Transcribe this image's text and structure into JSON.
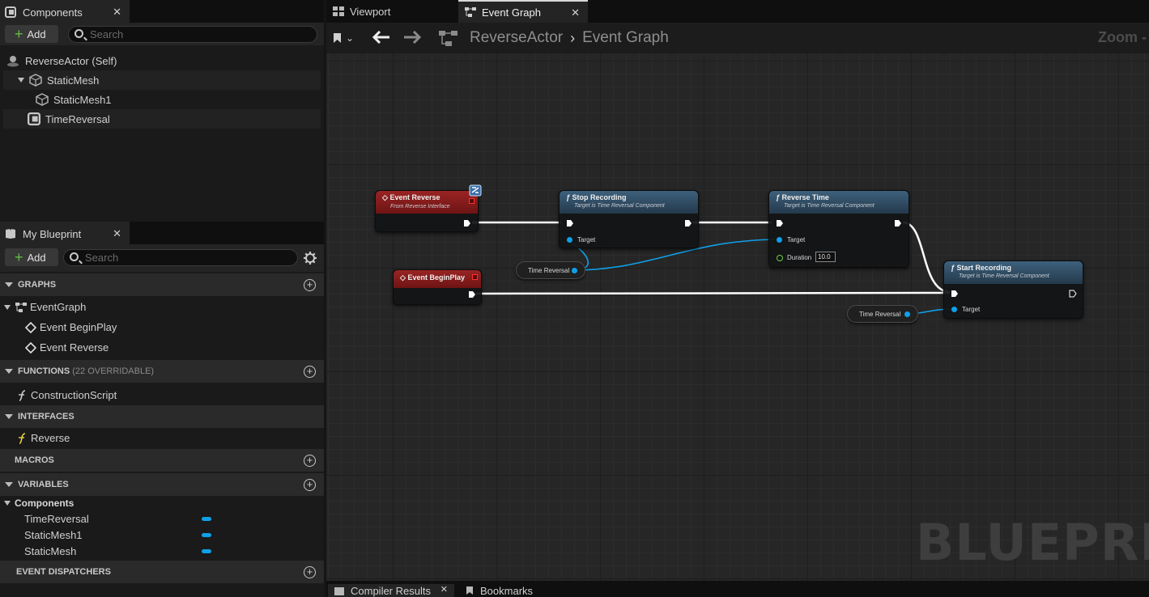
{
  "components_panel": {
    "title": "Components",
    "add_label": "Add",
    "search_placeholder": "Search",
    "tree": [
      "ReverseActor (Self)",
      "StaticMesh",
      "StaticMesh1",
      "TimeReversal"
    ]
  },
  "my_blueprint": {
    "title": "My Blueprint",
    "add_label": "Add",
    "search_placeholder": "Search",
    "sections": {
      "graphs": "GRAPHS",
      "functions": "FUNCTIONS",
      "functions_note": "(22 OVERRIDABLE)",
      "interfaces": "INTERFACES",
      "macros": "MACROS",
      "variables": "VARIABLES",
      "event_dispatchers": "EVENT DISPATCHERS"
    },
    "graphs": [
      "EventGraph",
      "Event BeginPlay",
      "Event Reverse"
    ],
    "functions": [
      "ConstructionScript"
    ],
    "interfaces": [
      "Reverse"
    ],
    "variables_category": "Components",
    "variables": [
      "TimeReversal",
      "StaticMesh1",
      "StaticMesh"
    ]
  },
  "editor_tabs": [
    "Viewport",
    "Event Graph"
  ],
  "breadcrumb": {
    "root": "ReverseActor",
    "current": "Event Graph"
  },
  "zoom_label": "Zoom -",
  "watermark": "BLUEPRINT",
  "nodes": {
    "event_reverse": {
      "title": "Event Reverse",
      "subtitle": "From Reverse Interface"
    },
    "event_beginplay": {
      "title": "Event BeginPlay"
    },
    "stop_recording": {
      "title": "Stop Recording",
      "subtitle": "Target is Time Reversal Component",
      "pin": "Target"
    },
    "reverse_time": {
      "title": "Reverse Time",
      "subtitle": "Target is Time Reversal Component",
      "pin_target": "Target",
      "pin_duration": "Duration",
      "duration_value": "10.0"
    },
    "start_recording": {
      "title": "Start Recording",
      "subtitle": "Target is Time Reversal Component",
      "pin": "Target"
    },
    "var1": "Time Reversal",
    "var2": "Time Reversal"
  },
  "bottom_tabs": [
    "Compiler Results",
    "Bookmarks"
  ],
  "colors": {
    "event_red": "#8a1c1c",
    "function_blue": "#2f4b61",
    "object_pin": "#0fa0e8",
    "exec_wire": "#ffffff"
  }
}
